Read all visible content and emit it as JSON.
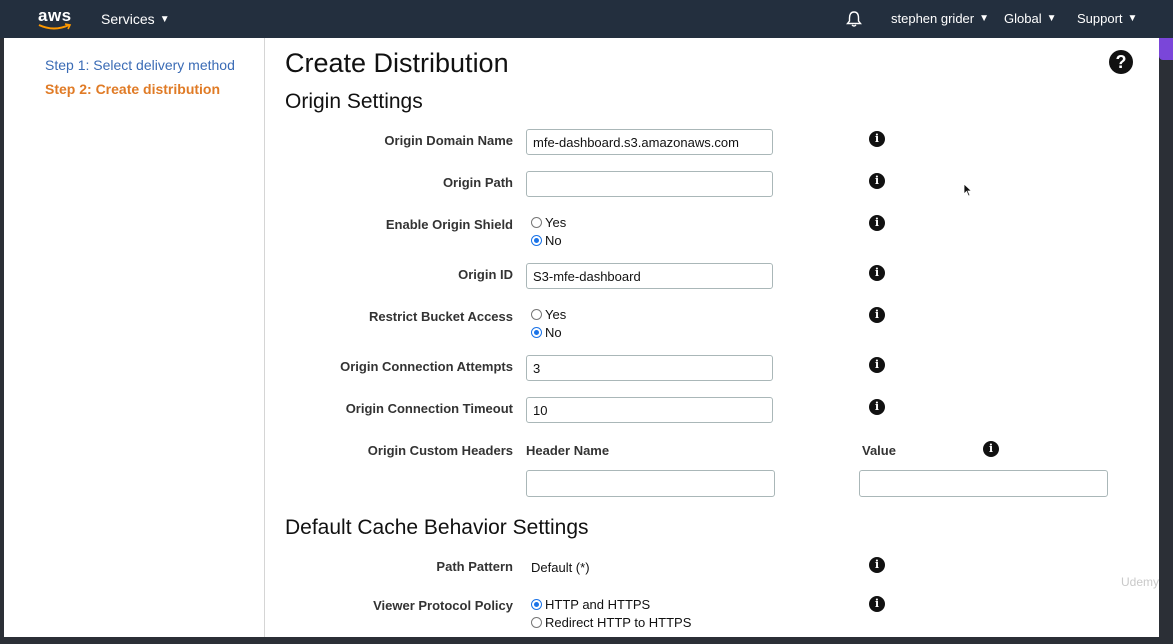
{
  "nav": {
    "logo_text": "aws",
    "services": "Services",
    "user": "stephen grider",
    "region": "Global",
    "support": "Support"
  },
  "sidebar": {
    "step1": "Step 1: Select delivery method",
    "step2": "Step 2: Create distribution"
  },
  "page": {
    "title": "Create Distribution",
    "origin_section": "Origin Settings",
    "cache_section": "Default Cache Behavior Settings"
  },
  "origin": {
    "domain_label": "Origin Domain Name",
    "domain_value": "mfe-dashboard.s3.amazonaws.com",
    "path_label": "Origin Path",
    "path_value": "",
    "shield_label": "Enable Origin Shield",
    "shield_yes": "Yes",
    "shield_no": "No",
    "id_label": "Origin ID",
    "id_value": "S3-mfe-dashboard",
    "restrict_label": "Restrict Bucket Access",
    "restrict_yes": "Yes",
    "restrict_no": "No",
    "attempts_label": "Origin Connection Attempts",
    "attempts_value": "3",
    "timeout_label": "Origin Connection Timeout",
    "timeout_value": "10",
    "headers_label": "Origin Custom Headers",
    "header_name_col": "Header Name",
    "value_col": "Value"
  },
  "cache": {
    "path_pattern_label": "Path Pattern",
    "path_pattern_value": "Default (*)",
    "viewer_policy_label": "Viewer Protocol Policy",
    "opt_http_https": "HTTP and HTTPS",
    "opt_redirect": "Redirect HTTP to HTTPS"
  },
  "watermark": "Udemy",
  "colors": {
    "nav_bg": "#232f3e",
    "link": "#3a6bb5",
    "active_step": "#e07b26",
    "radio_accent": "#1a73e8"
  }
}
